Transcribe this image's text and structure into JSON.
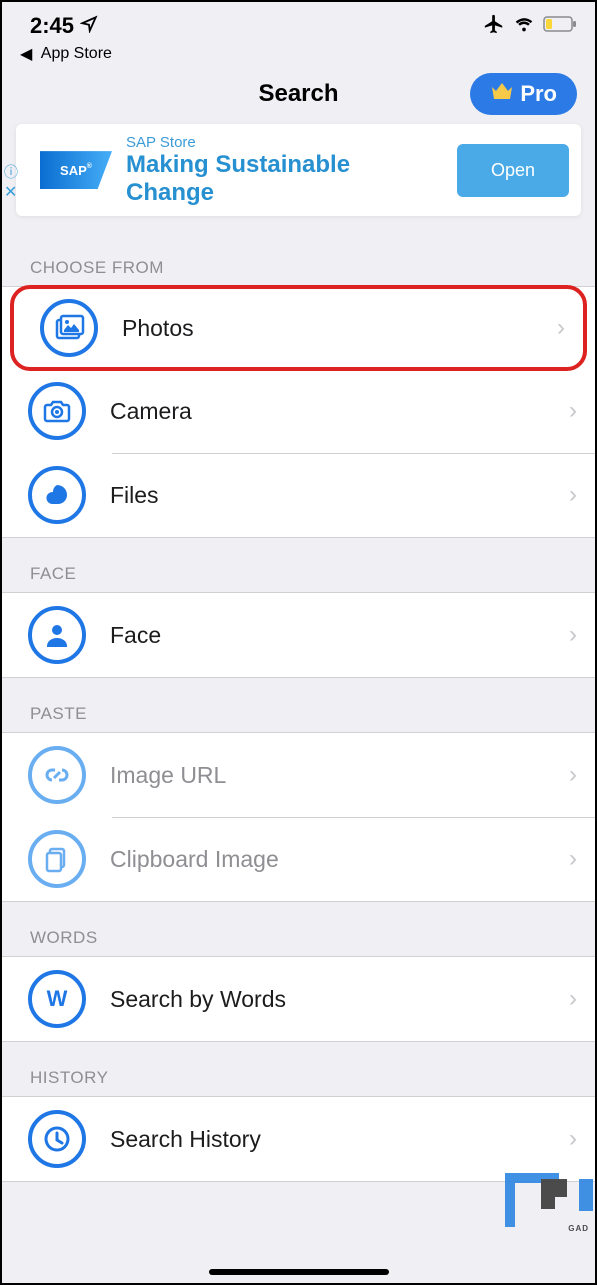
{
  "status": {
    "time": "2:45",
    "back_app_label": "App Store"
  },
  "nav": {
    "title": "Search",
    "pro_label": "Pro"
  },
  "ad": {
    "store_label": "SAP Store",
    "headline": "Making Sustainable Change",
    "cta_label": "Open",
    "logo_text": "SAP"
  },
  "sections": {
    "choose_from": {
      "header": "CHOOSE FROM",
      "photos_label": "Photos",
      "camera_label": "Camera",
      "files_label": "Files"
    },
    "face": {
      "header": "FACE",
      "face_label": "Face"
    },
    "paste": {
      "header": "PASTE",
      "image_url_label": "Image URL",
      "clipboard_label": "Clipboard Image"
    },
    "words": {
      "header": "WORDS",
      "search_words_label": "Search by Words"
    },
    "history": {
      "header": "HISTORY",
      "search_history_label": "Search History"
    }
  },
  "watermark_text": "GAD"
}
